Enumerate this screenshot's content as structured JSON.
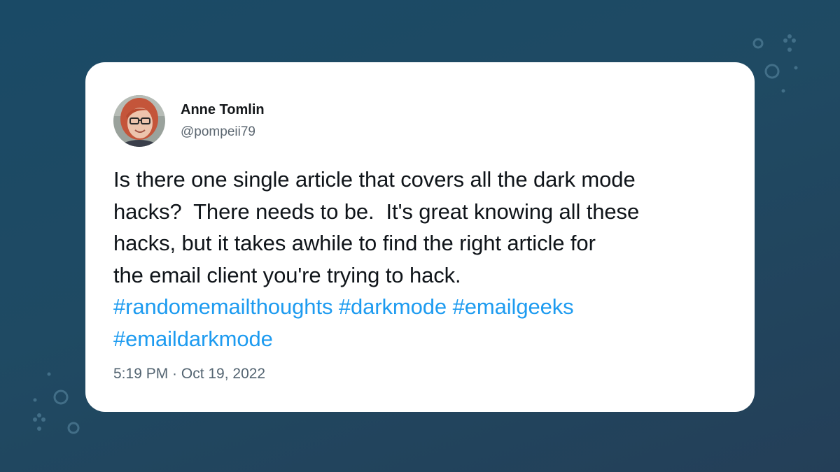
{
  "colors": {
    "background": "#1f4a63",
    "card": "#ffffff",
    "text": "#0f1419",
    "muted": "#536471",
    "hashtag": "#1d9bf0"
  },
  "tweet": {
    "author": {
      "name": "Anne Tomlin",
      "handle": "@pompeii79",
      "avatar_icon": "profile-photo"
    },
    "text_lines": [
      "Is there one single article that covers all the dark mode",
      "hacks?  There needs to be.  It's great knowing all these",
      "hacks, but it takes awhile to find the right article for",
      "the email client you're trying to hack."
    ],
    "hashtag_lines": [
      [
        "#randomemailthoughts",
        "#darkmode",
        "#emailgeeks"
      ],
      [
        "#emaildarkmode"
      ]
    ],
    "timestamp": "5:19 PM · Oct 19, 2022"
  }
}
